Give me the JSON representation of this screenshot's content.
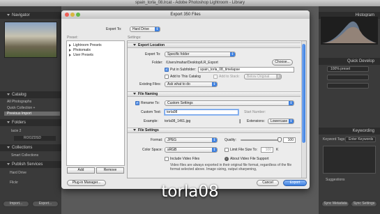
{
  "window": {
    "title": "spain_torla_08.lrcat - Adobe Photoshop Lightroom - Library"
  },
  "lightroom": {
    "left_panels": {
      "navigator": "Navigator",
      "catalog": "Catalog",
      "catalog_items": [
        "All Photographs",
        "Quick Collection +",
        "Previous Import"
      ],
      "folders": "Folders",
      "folder_items": [
        "lacie 2",
        "ROOZDSD"
      ],
      "collections": "Collections",
      "collection_items": [
        "Smart Collections"
      ],
      "publish_services": "Publish Services",
      "publish_items": [
        "Hard Drive",
        "Flickr"
      ],
      "bottom_buttons": [
        "Import...",
        "Export..."
      ]
    },
    "right_panels": {
      "histogram": "Histogram",
      "quick_develop": "Quick Develop",
      "quick_develop_value": "100% preset",
      "keywording": "Keywording",
      "keyword_tags_label": "Keyword Tags",
      "keyword_tags_value": "Enter Keywords",
      "suggestions": "Suggestions",
      "bottom_buttons": [
        "Sync Metadata",
        "Sync Settings"
      ]
    }
  },
  "dialog": {
    "title": "Export 350 Files",
    "export_to_label": "Export To:",
    "export_to_value": "Hard Drive",
    "preset_label": "Preset:",
    "settings_label": "Settings:",
    "presets": [
      "Lightroom Presets",
      "Photomatix",
      "User Presets"
    ],
    "add_button": "Add",
    "remove_button": "Remove",
    "sections": {
      "export_location": {
        "header": "Export Location",
        "export_to_label": "Export To:",
        "export_to_value": "Specific folder",
        "folder_label": "Folder:",
        "folder_value": "/Users/mahar/Desktop/LR_Export",
        "choose_button": "Choose...",
        "put_in_subfolder_label": "Put in Subfolder:",
        "put_in_subfolder_checked": true,
        "subfolder_value": "spain_torla_08_timelapse",
        "add_to_catalog_label": "Add to This Catalog",
        "add_to_catalog_checked": false,
        "add_to_stack_label": "Add to Stack:",
        "add_to_stack_checked": false,
        "below_original_value": "Below Original",
        "existing_files_label": "Existing Files:",
        "existing_files_value": "Ask what to do"
      },
      "file_naming": {
        "header": "File Naming",
        "rename_to_label": "Rename To:",
        "rename_to_checked": true,
        "rename_to_value": "Custom Settings",
        "custom_text_label": "Custom Text:",
        "custom_text_value": "torla08",
        "start_number_label": "Start Number:",
        "example_label": "Example:",
        "example_value": "torla08_1461.jpg",
        "extensions_label": "Extensions:",
        "extensions_value": "Lowercase"
      },
      "file_settings": {
        "header": "File Settings",
        "format_label": "Format:",
        "format_value": "JPEG",
        "quality_label": "Quality:",
        "quality_value": "100",
        "quality_fraction": 1.0,
        "color_space_label": "Color Space:",
        "color_space_value": "sRGB",
        "limit_file_size_label": "Limit File Size To:",
        "limit_file_size_checked": false,
        "limit_file_size_value": "100",
        "limit_file_size_unit": "K",
        "include_video_label": "Include Video Files",
        "include_video_checked": false,
        "video_support_label": "About Video File Support",
        "video_note": "Video files are always exported in their original file format, regardless of the file format selected above. Image sizing, output sharpening,"
      }
    },
    "plugin_manager_button": "Plug-in Manager...",
    "cancel_button": "Cancel",
    "export_button": "Export"
  },
  "caption": "torla08",
  "colors": {
    "accent_blue": "#3b7fe0",
    "dialog_bg": "#e8e8e8",
    "lightroom_panel": "#3a3a3a"
  }
}
